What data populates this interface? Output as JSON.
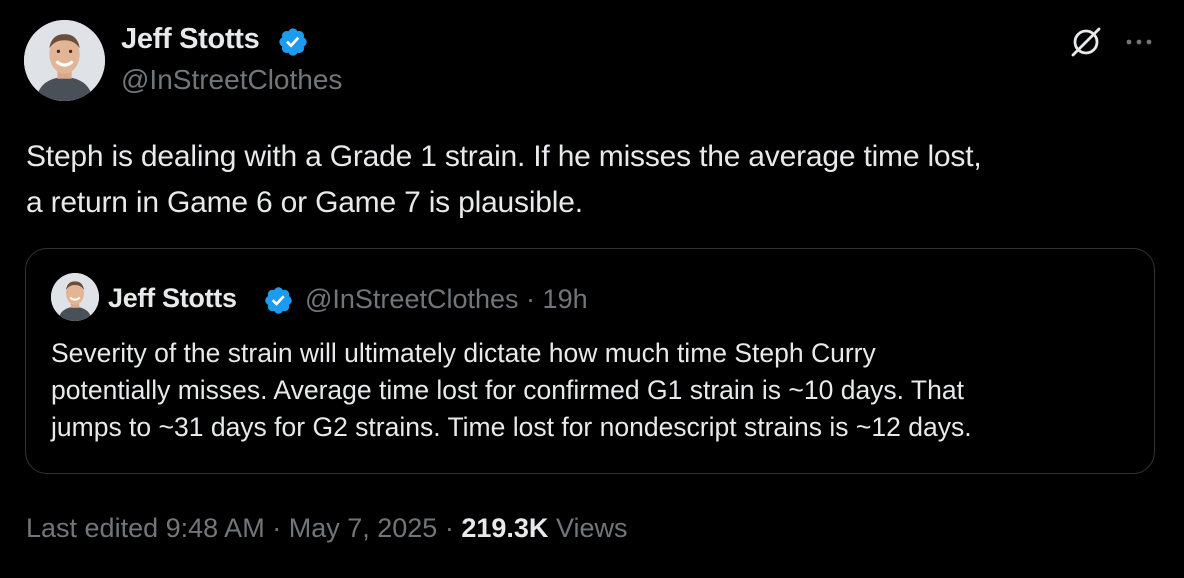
{
  "author": {
    "name": "Jeff Stotts",
    "handle": "@InStreetClothes",
    "verified": true,
    "avatar_icon": "profile-photo-avatar"
  },
  "icons": {
    "grok": "grok-icon",
    "more": "more-options-icon",
    "verified": "verified-badge-icon"
  },
  "tweet": {
    "lines": [
      "Steph is dealing with a Grade 1 strain. If he misses the average time lost,",
      "a return in Game 6 or Game 7 is plausible."
    ]
  },
  "quote": {
    "name": "Jeff Stotts",
    "handle": "@InStreetClothes",
    "separator": "·",
    "time": "19h",
    "lines": [
      "Severity of the strain will ultimately dictate how much time Steph Curry",
      "potentially misses. Average time lost for confirmed G1 strain is ~10 days. That",
      "jumps to ~31 days for G2 strains. Time lost for nondescript strains is ~12 days."
    ]
  },
  "footer": {
    "edited_prefix": "Last edited",
    "time": "9:48 AM",
    "separator": "·",
    "date": "May 7, 2025",
    "views_count": "219.3K",
    "views_label": "Views"
  },
  "colors": {
    "background": "#000000",
    "text": "#e7e9ea",
    "muted": "#71767b",
    "verified": "#1d9bf0",
    "border": "#2f3336"
  }
}
